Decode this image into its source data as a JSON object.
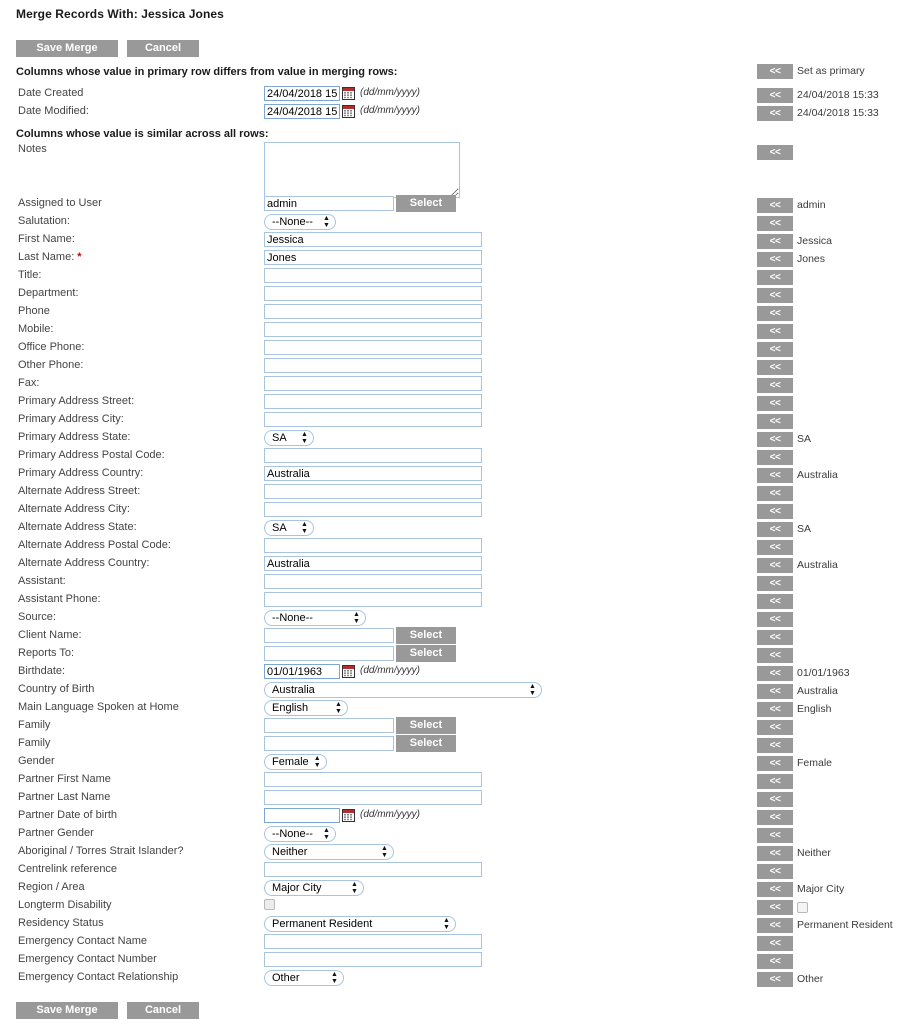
{
  "page": {
    "title": "Merge Records With: Jessica Jones",
    "section_differs": "Columns whose value in primary row differs from value in merging rows:",
    "section_similar": "Columns whose value is similar across all rows:",
    "date_hint": "(dd/mm/yyyy)",
    "merge_button_label": "<<",
    "set_as_primary_label": "Set as primary",
    "select_label": "Select"
  },
  "toolbar": {
    "save_label": "Save Merge",
    "cancel_label": "Cancel"
  },
  "differ_rows": [
    {
      "label": "Date Created",
      "value": "24/04/2018 15:33",
      "merge_value": "24/04/2018 15:33"
    },
    {
      "label": "Date Modified:",
      "value": "24/04/2018 15:33",
      "merge_value": "24/04/2018 15:33"
    }
  ],
  "notes_row": {
    "label": "Notes",
    "value": "",
    "merge_value": ""
  },
  "rows": [
    {
      "label": "Assigned to User",
      "type": "text-select",
      "value": "admin",
      "merge_value": "admin"
    },
    {
      "label": "Salutation:",
      "type": "select",
      "value": "--None--",
      "merge_value": "",
      "sel_w": 72
    },
    {
      "label": "First Name:",
      "type": "text",
      "value": "Jessica",
      "merge_value": "Jessica"
    },
    {
      "label": "Last Name:",
      "type": "text",
      "value": "Jones",
      "merge_value": "Jones",
      "required": true
    },
    {
      "label": "Title:",
      "type": "text",
      "value": "",
      "merge_value": ""
    },
    {
      "label": "Department:",
      "type": "text",
      "value": "",
      "merge_value": ""
    },
    {
      "label": "Phone",
      "type": "text",
      "value": "",
      "merge_value": ""
    },
    {
      "label": "Mobile:",
      "type": "text",
      "value": "",
      "merge_value": ""
    },
    {
      "label": "Office Phone:",
      "type": "text",
      "value": "",
      "merge_value": ""
    },
    {
      "label": "Other Phone:",
      "type": "text",
      "value": "",
      "merge_value": ""
    },
    {
      "label": "Fax:",
      "type": "text",
      "value": "",
      "merge_value": ""
    },
    {
      "label": "Primary Address Street:",
      "type": "text",
      "value": "",
      "merge_value": ""
    },
    {
      "label": "Primary Address City:",
      "type": "text",
      "value": "",
      "merge_value": ""
    },
    {
      "label": "Primary Address State:",
      "type": "select",
      "value": "SA",
      "merge_value": "SA",
      "sel_w": 50
    },
    {
      "label": "Primary Address Postal Code:",
      "type": "text",
      "value": "",
      "merge_value": ""
    },
    {
      "label": "Primary Address Country:",
      "type": "text",
      "value": "Australia",
      "merge_value": "Australia"
    },
    {
      "label": "Alternate Address Street:",
      "type": "text",
      "value": "",
      "merge_value": ""
    },
    {
      "label": "Alternate Address City:",
      "type": "text",
      "value": "",
      "merge_value": ""
    },
    {
      "label": "Alternate Address State:",
      "type": "select",
      "value": "SA",
      "merge_value": "SA",
      "sel_w": 50
    },
    {
      "label": "Alternate Address Postal Code:",
      "type": "text",
      "value": "",
      "merge_value": ""
    },
    {
      "label": "Alternate Address Country:",
      "type": "text",
      "value": "Australia",
      "merge_value": "Australia"
    },
    {
      "label": "Assistant:",
      "type": "text",
      "value": "",
      "merge_value": ""
    },
    {
      "label": "Assistant Phone:",
      "type": "text",
      "value": "",
      "merge_value": ""
    },
    {
      "label": "Source:",
      "type": "select",
      "value": "--None--",
      "merge_value": "",
      "sel_w": 102
    },
    {
      "label": "Client Name:",
      "type": "text-select",
      "value": "",
      "merge_value": ""
    },
    {
      "label": "Reports To:",
      "type": "text-select",
      "value": "",
      "merge_value": ""
    },
    {
      "label": "Birthdate:",
      "type": "date",
      "value": "01/01/1963",
      "merge_value": "01/01/1963"
    },
    {
      "label": "Country of Birth",
      "type": "select",
      "value": "Australia",
      "merge_value": "Australia",
      "sel_w": 278
    },
    {
      "label": "Main Language Spoken at Home",
      "type": "select",
      "value": "English",
      "merge_value": "English",
      "sel_w": 84
    },
    {
      "label": "Family",
      "type": "text-select",
      "value": "",
      "merge_value": ""
    },
    {
      "label": "Family",
      "type": "text-select",
      "value": "",
      "merge_value": ""
    },
    {
      "label": "Gender",
      "type": "select",
      "value": "Female",
      "merge_value": "Female",
      "sel_w": 62
    },
    {
      "label": "Partner First Name",
      "type": "text",
      "value": "",
      "merge_value": ""
    },
    {
      "label": "Partner Last Name",
      "type": "text",
      "value": "",
      "merge_value": ""
    },
    {
      "label": "Partner Date of birth",
      "type": "date",
      "value": "",
      "merge_value": ""
    },
    {
      "label": "Partner Gender",
      "type": "select",
      "value": "--None--",
      "merge_value": "",
      "sel_w": 72
    },
    {
      "label": "Aboriginal / Torres Strait Islander?",
      "type": "select",
      "value": "Neither",
      "merge_value": "Neither",
      "sel_w": 130
    },
    {
      "label": "Centrelink reference",
      "type": "text",
      "value": "",
      "merge_value": ""
    },
    {
      "label": "Region / Area",
      "type": "select",
      "value": "Major City",
      "merge_value": "Major City",
      "sel_w": 100
    },
    {
      "label": "Longterm Disability",
      "type": "checkbox",
      "value": false,
      "merge_value": false
    },
    {
      "label": "Residency Status",
      "type": "select",
      "value": "Permanent Resident",
      "merge_value": "Permanent Resident",
      "sel_w": 192
    },
    {
      "label": "Emergency Contact Name",
      "type": "text",
      "value": "",
      "merge_value": ""
    },
    {
      "label": "Emergency Contact Number",
      "type": "text",
      "value": "",
      "merge_value": ""
    },
    {
      "label": "Emergency Contact Relationship",
      "type": "select",
      "value": "Other",
      "merge_value": "Other",
      "sel_w": 80
    }
  ]
}
